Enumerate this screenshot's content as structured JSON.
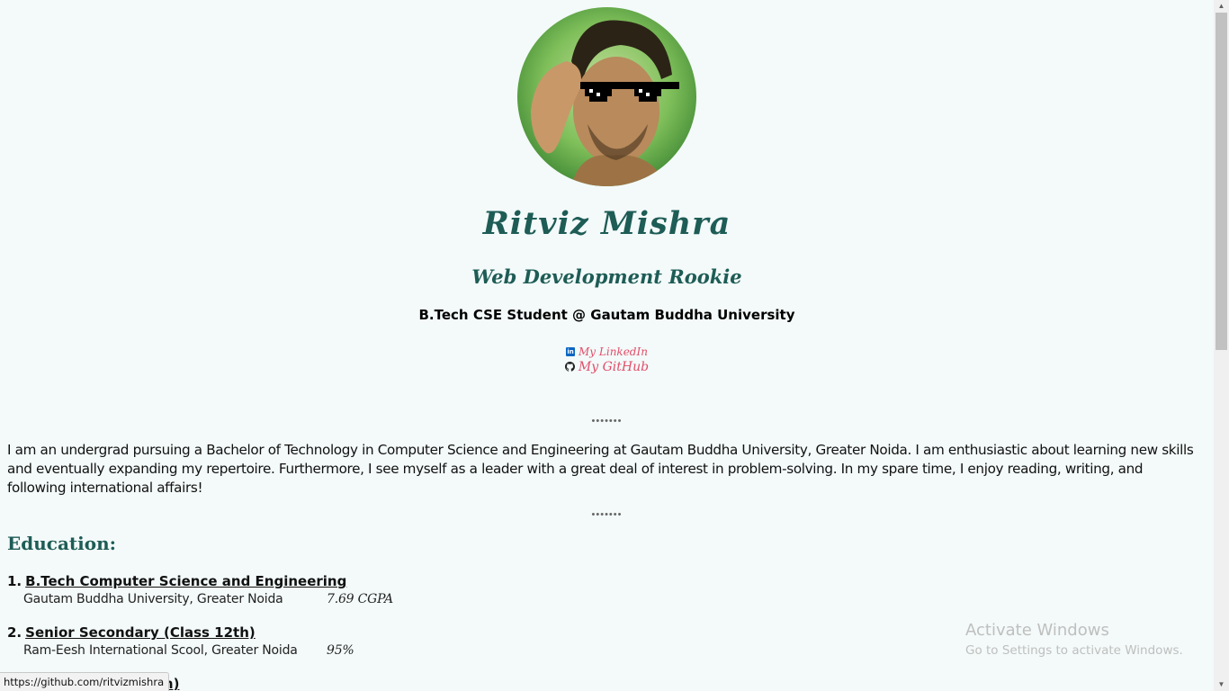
{
  "profile": {
    "name": "Ritviz Mishra",
    "subtitle": "Web Development Rookie",
    "tagline": "B.Tech CSE Student @ Gautam Buddha University"
  },
  "links": {
    "linkedin_label": "My LinkedIn",
    "github_label": "My GitHub"
  },
  "separator": "•••••••",
  "about": "I am an undergrad pursuing a Bachelor of Technology in Computer Science and Engineering at Gautam Buddha University, Greater Noida. I am enthusiastic about learning new skills and eventually expanding my repertoire. Furthermore, I see myself as a leader with a great deal of interest in problem-solving. In my spare time, I enjoy reading, writing, and following international affairs!",
  "education": {
    "heading": "Education:",
    "items": [
      {
        "num": "1.",
        "title": "B.Tech Computer Science and Engineering",
        "institution": "Gautam Buddha University, Greater Noida",
        "score": "7.69 CGPA"
      },
      {
        "num": "2.",
        "title": "Senior Secondary (Class 12th)",
        "institution": "Ram-Eesh International Scool, Greater Noida",
        "score": "95%"
      },
      {
        "num": "",
        "title": "ch)",
        "institution": "",
        "score": ""
      }
    ]
  },
  "watermark": {
    "line1": "Activate Windows",
    "line2": "Go to Settings to activate Windows."
  },
  "status_bar": {
    "url": "https://github.com/ritvizmishra"
  }
}
